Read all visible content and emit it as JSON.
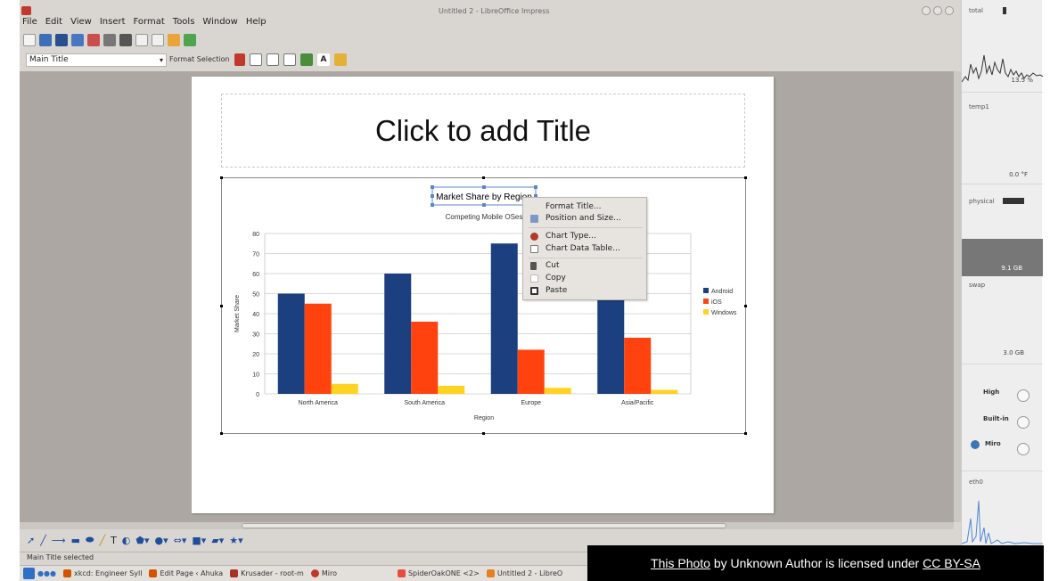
{
  "window": {
    "title": "Untitled 2 - LibreOffice Impress"
  },
  "menu": [
    "File",
    "Edit",
    "View",
    "Insert",
    "Format",
    "Tools",
    "Window",
    "Help"
  ],
  "formatting_toolbar": {
    "style_value": "Main Title",
    "format_selection_label": "Format Selection"
  },
  "slide": {
    "title_placeholder": "Click to add Title"
  },
  "chart_data": {
    "type": "bar",
    "title": "Market Share by Region",
    "subtitle": "Competing Mobile OSes",
    "xlabel": "Region",
    "ylabel": "Market Share",
    "ylim": [
      0,
      80
    ],
    "yticks": [
      0,
      10,
      20,
      30,
      40,
      50,
      60,
      70,
      80
    ],
    "categories": [
      "North America",
      "South America",
      "Europe",
      "Asia/Pacific"
    ],
    "series": [
      {
        "name": "Android",
        "color": "#1b3f7f",
        "values": [
          50,
          60,
          75,
          49
        ]
      },
      {
        "name": "iOS",
        "color": "#ff420e",
        "values": [
          45,
          36,
          22,
          28
        ]
      },
      {
        "name": "Windows",
        "color": "#ffd320",
        "values": [
          5,
          4,
          3,
          2
        ]
      }
    ],
    "grid": true,
    "legend_position": "right"
  },
  "context_menu": {
    "items": [
      {
        "label": "Format Title...",
        "icon": "none"
      },
      {
        "label": "Position and Size...",
        "icon": "position-size-icon"
      },
      {
        "label": "Chart Type...",
        "icon": "chart-type-icon"
      },
      {
        "label": "Chart Data Table...",
        "icon": "data-table-icon"
      },
      {
        "label": "Cut",
        "icon": "cut-icon"
      },
      {
        "label": "Copy",
        "icon": "copy-icon"
      },
      {
        "label": "Paste",
        "icon": "paste-icon"
      }
    ]
  },
  "status": {
    "text": "Main Title selected"
  },
  "taskbar": {
    "items": [
      "xkcd: Engineer Syll",
      "Edit Page ‹ Ahuka",
      "Krusader - root-m",
      "Miro",
      "SpiderOakONE <2>",
      "Untitled 2 - LibreO"
    ]
  },
  "system_monitor": {
    "total_label": "total",
    "cpu_value": "13.5 %",
    "temp_label": "temp1",
    "temp_value": "0.0 °F",
    "physical_label": "physical",
    "physical_value": "9.1 GB",
    "swap_label": "swap",
    "swap_value": "3.0 GB",
    "sound_high": "High",
    "sound_builtin": "Built-in",
    "sound_miro": "Miro",
    "net_label": "eth0"
  },
  "credit": {
    "link_text": "This Photo",
    "middle_text": " by Unknown Author is licensed under ",
    "license_text": "CC BY-SA"
  }
}
